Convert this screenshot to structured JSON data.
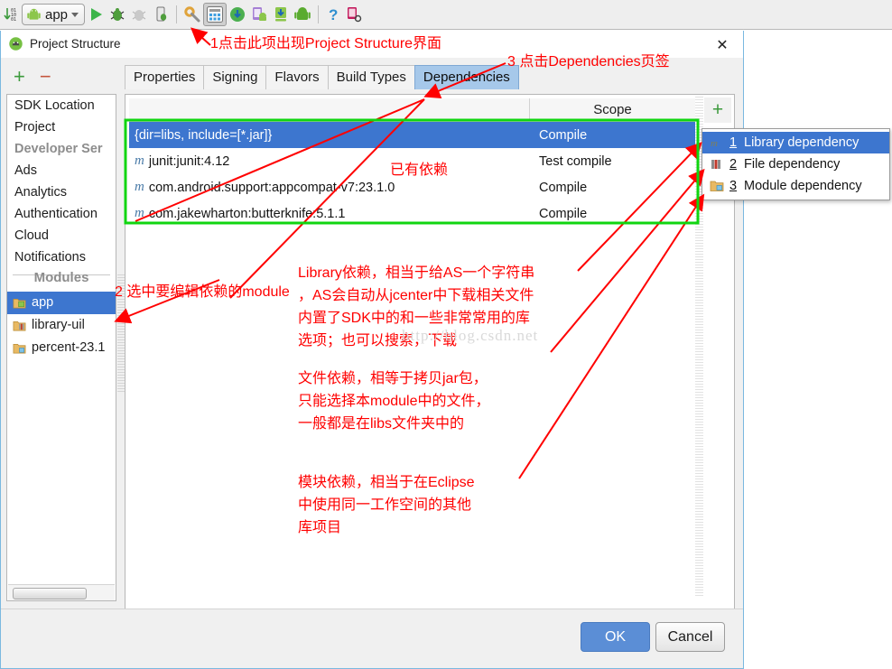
{
  "ide_toolbar": {
    "run_config_label": "app",
    "icons": [
      {
        "name": "build-variants-icon"
      },
      {
        "name": "run-config-selector"
      },
      {
        "name": "run-icon"
      },
      {
        "name": "debug-icon"
      },
      {
        "name": "debug-disabled-icon"
      },
      {
        "name": "attach-debugger-icon"
      },
      {
        "name": "sync-gradle-icon"
      },
      {
        "name": "project-structure-icon"
      },
      {
        "name": "sdk-manager-icon"
      },
      {
        "name": "avd-manager-icon"
      },
      {
        "name": "download-android-icon"
      },
      {
        "name": "android-device-monitor-icon"
      },
      {
        "name": "help-icon"
      },
      {
        "name": "layout-inspector-icon"
      }
    ]
  },
  "dialog": {
    "title": "Project Structure",
    "close_label": "✕",
    "add_button": "+",
    "remove_button": "−"
  },
  "sidebar": {
    "items": [
      {
        "label": "SDK Location",
        "style": "normal"
      },
      {
        "label": "Project",
        "style": "normal"
      },
      {
        "label": "Developer Ser",
        "style": "dim"
      },
      {
        "label": "Ads",
        "style": "normal"
      },
      {
        "label": "Analytics",
        "style": "normal"
      },
      {
        "label": "Authentication",
        "style": "normal"
      },
      {
        "label": "Cloud",
        "style": "normal"
      },
      {
        "label": "Notifications",
        "style": "normal"
      }
    ],
    "group_label": "Modules",
    "modules": [
      {
        "label": "app",
        "icon": "module-app-icon",
        "selected": true
      },
      {
        "label": "library-uil",
        "icon": "module-library-icon",
        "selected": false
      },
      {
        "label": "percent-23.1",
        "icon": "module-folder-icon",
        "selected": false
      }
    ]
  },
  "tabs": [
    {
      "label": "Properties",
      "active": false
    },
    {
      "label": "Signing",
      "active": false
    },
    {
      "label": "Flavors",
      "active": false
    },
    {
      "label": "Build Types",
      "active": false
    },
    {
      "label": "Dependencies",
      "active": true
    }
  ],
  "dependencies_table": {
    "columns": [
      "",
      "Scope"
    ],
    "scope_header": "Scope",
    "rows": [
      {
        "icon": "",
        "name": "{dir=libs, include=[*.jar]}",
        "scope": "Compile",
        "selected": true
      },
      {
        "icon": "m",
        "name": "junit:junit:4.12",
        "scope": "Test compile",
        "selected": false
      },
      {
        "icon": "m",
        "name": "com.android.support:appcompat-v7:23.1.0",
        "scope": "Compile",
        "selected": false
      },
      {
        "icon": "m",
        "name": "com.jakewharton:butterknife:5.1.1",
        "scope": "Compile",
        "selected": false
      }
    ]
  },
  "context_menu": {
    "items": [
      {
        "num": "1",
        "label": "Library dependency",
        "icon": "library-dependency-icon",
        "selected": true
      },
      {
        "num": "2",
        "label": "File dependency",
        "icon": "file-dependency-icon",
        "selected": false
      },
      {
        "num": "3",
        "label": "Module dependency",
        "icon": "module-dependency-icon",
        "selected": false
      }
    ]
  },
  "footer": {
    "ok_label": "OK",
    "cancel_label": "Cancel"
  },
  "annotations": {
    "step1": "1点击此项出现Project Structure界面",
    "step3": "3 点击Dependencies页签",
    "step2": "2 选中要编辑依赖的module",
    "existing_deps": "已有依赖",
    "library_note": "Library依赖，相当于给AS一个字符串\n，AS会自动从jcenter中下载相关文件\n内置了SDK中的和一些非常常用的库\n选项；也可以搜索，下载",
    "file_note": "文件依赖，相等于拷贝jar包，\n只能选择本module中的文件，\n一般都是在libs文件夹中的",
    "module_note": "模块依赖，相当于在Eclipse\n中使用同一工作空间的其他\n库项目",
    "watermark": "http://blog.csdn.net",
    "accent_red": "#ff0000",
    "accent_green": "#10d510"
  }
}
